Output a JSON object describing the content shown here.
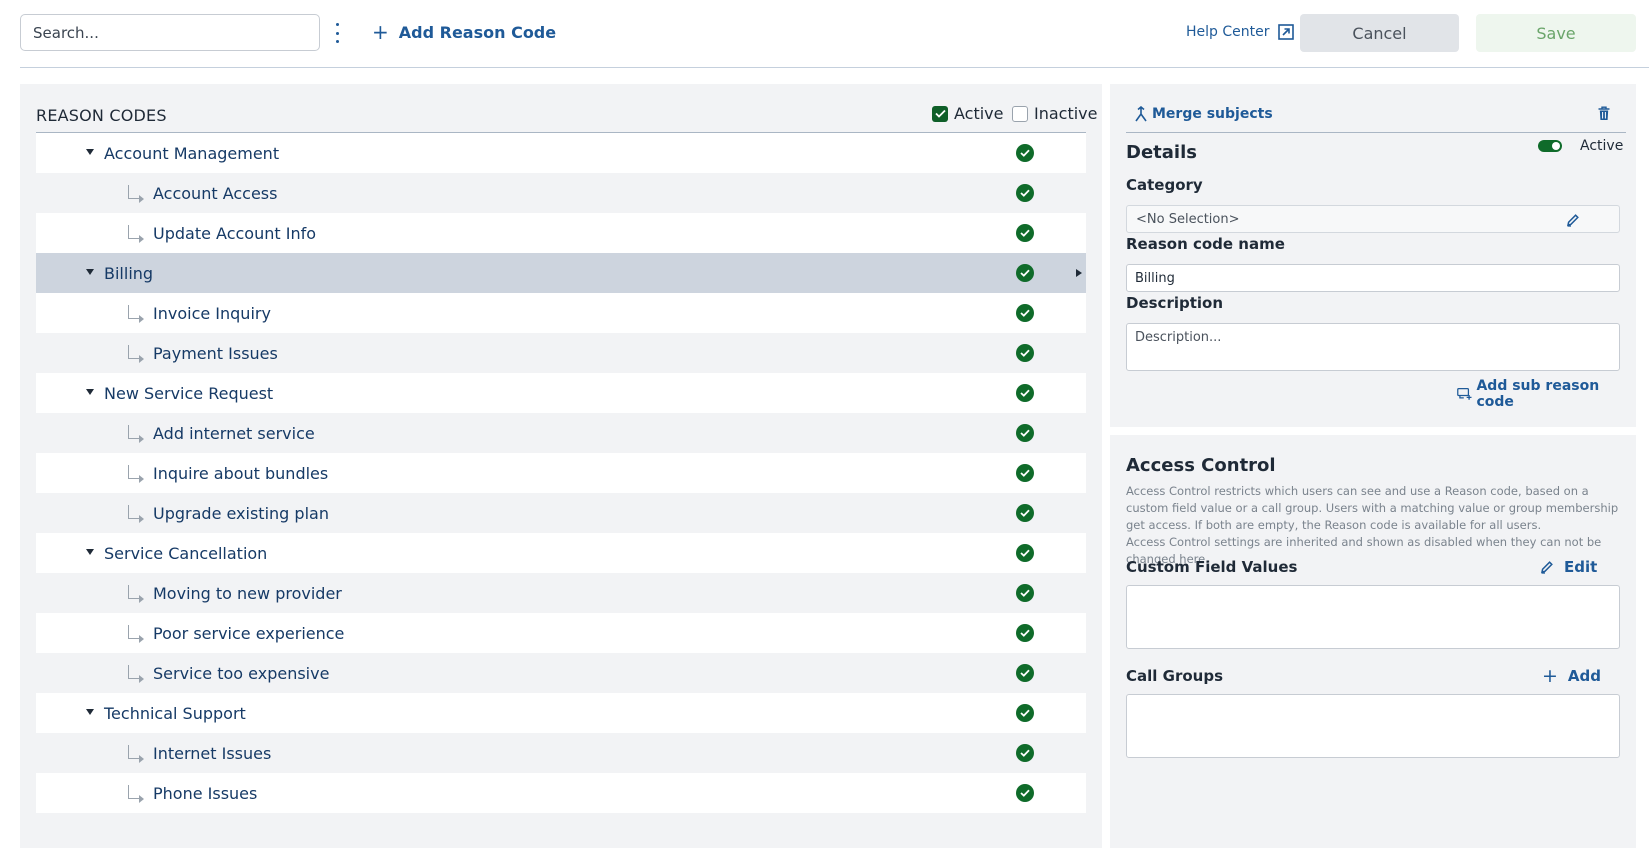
{
  "toolbar": {
    "search_placeholder": "Search...",
    "more_icon": "kebab-vertical-icon",
    "add_reason_plus": "+",
    "add_reason_label": "Add Reason Code",
    "help_label": "Help Center",
    "help_icon": "external-link-icon",
    "cancel_label": "Cancel",
    "save_label": "Save"
  },
  "reason_codes": {
    "title": "REASON CODES",
    "filter_active_label": "Active",
    "filter_active_checked": true,
    "filter_inactive_label": "Inactive",
    "filter_inactive_checked": false,
    "status_icon": "check-circle-icon",
    "rows": [
      {
        "label": "Account Management",
        "level": "parent",
        "active": true
      },
      {
        "label": "Account Access",
        "level": "child",
        "active": true
      },
      {
        "label": "Update Account Info",
        "level": "child",
        "active": true
      },
      {
        "label": "Billing",
        "level": "parent",
        "active": true,
        "selected": true
      },
      {
        "label": "Invoice Inquiry",
        "level": "child",
        "active": true
      },
      {
        "label": "Payment Issues",
        "level": "child",
        "active": true
      },
      {
        "label": "New Service Request",
        "level": "parent",
        "active": true
      },
      {
        "label": "Add internet service",
        "level": "child",
        "active": true
      },
      {
        "label": "Inquire about bundles",
        "level": "child",
        "active": true
      },
      {
        "label": "Upgrade existing plan",
        "level": "child",
        "active": true
      },
      {
        "label": "Service Cancellation",
        "level": "parent",
        "active": true
      },
      {
        "label": "Moving to new provider",
        "level": "child",
        "active": true
      },
      {
        "label": "Poor service experience",
        "level": "child",
        "active": true
      },
      {
        "label": "Service too expensive",
        "level": "child",
        "active": true
      },
      {
        "label": "Technical Support",
        "level": "parent",
        "active": true
      },
      {
        "label": "Internet Issues",
        "level": "child",
        "active": true
      },
      {
        "label": "Phone Issues",
        "level": "child",
        "active": true
      }
    ]
  },
  "details": {
    "merge_label": "Merge subjects",
    "merge_icon": "merge-icon",
    "delete_icon": "trash-icon",
    "title": "Details",
    "active_toggle_on": true,
    "active_label": "Active",
    "category_label": "Category",
    "category_value": "<No Selection>",
    "edit_icon": "pencil-icon",
    "name_label": "Reason code name",
    "name_value": "Billing",
    "description_label": "Description",
    "description_placeholder": "Description...",
    "add_sub_label": "Add sub reason code",
    "add_sub_icon": "add-sub-icon"
  },
  "access_control": {
    "title": "Access Control",
    "description_lines": [
      "Access Control restricts which users can see and use a Reason code, based on a custom field value or a call group. Users with a matching value or group membership get access. If both are empty, the Reason code is available for all users.",
      "Access Control settings are inherited and shown as disabled when they can not be changed here."
    ],
    "custom_field_label": "Custom Field Values",
    "custom_field_action": "Edit",
    "call_groups_label": "Call Groups",
    "call_groups_plus": "+",
    "call_groups_action": "Add"
  },
  "colors": {
    "accent": "#1f5a98",
    "success": "#0f6b2a",
    "selected_row": "#cdd4de",
    "panel_bg": "#f2f3f5"
  }
}
